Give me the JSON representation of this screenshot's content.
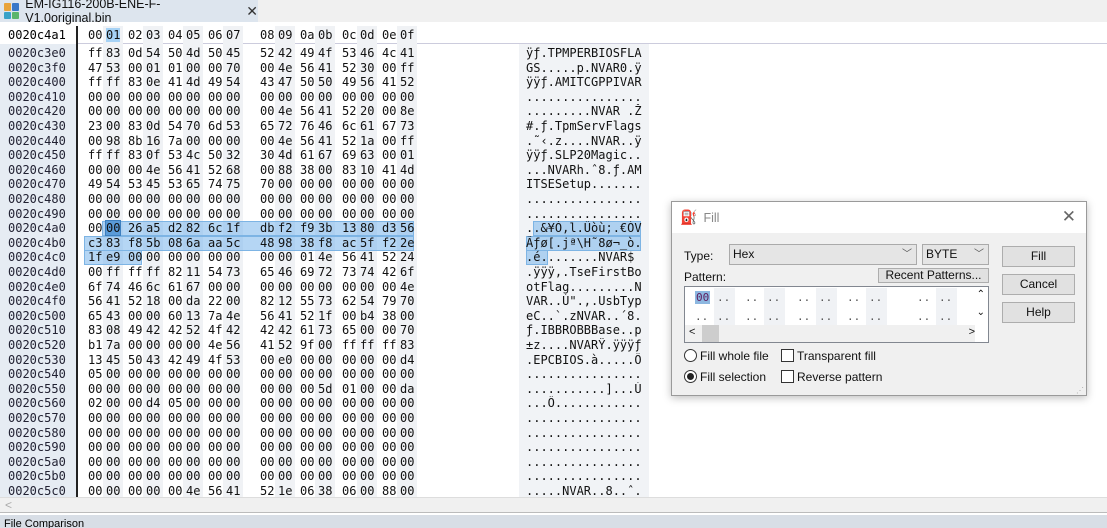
{
  "tab": {
    "filename": "EM-IG116-200B-ENE-F-V1.0original.bin",
    "close": "✕"
  },
  "header": {
    "cursor_address": "0020c4a1",
    "columns": [
      "00",
      "01",
      "02",
      "03",
      "04",
      "05",
      "06",
      "07",
      "08",
      "09",
      "0a",
      "0b",
      "0c",
      "0d",
      "0e",
      "0f"
    ],
    "active_column": 1
  },
  "rows": [
    {
      "addr": "0020c3e0",
      "hex": "ff 83 0d 54 50 4d 50 45 52 42 49 4f 53 46 4c 41",
      "ascii": "ÿƒ.TPMPERBIOSFLA"
    },
    {
      "addr": "0020c3f0",
      "hex": "47 53 00 01 01 00 00 70 00 4e 56 41 52 30 00 ff",
      "ascii": "GS.....p.NVAR0.ÿ"
    },
    {
      "addr": "0020c400",
      "hex": "ff ff 83 0e 41 4d 49 54 43 47 50 50 49 56 41 52",
      "ascii": "ÿÿƒ.AMITCGPPIVAR"
    },
    {
      "addr": "0020c410",
      "hex": "00 00 00 00 00 00 00 00 00 00 00 00 00 00 00 00",
      "ascii": "................"
    },
    {
      "addr": "0020c420",
      "hex": "00 00 00 00 00 00 00 00 00 4e 56 41 52 20 00 8e",
      "ascii": ".........NVAR .Ž"
    },
    {
      "addr": "0020c430",
      "hex": "23 00 83 0d 54 70 6d 53 65 72 76 46 6c 61 67 73",
      "ascii": "#.ƒ.TpmServFlags"
    },
    {
      "addr": "0020c440",
      "hex": "00 98 8b 16 7a 00 00 00 00 4e 56 41 52 1a 00 ff",
      "ascii": ".˜‹.z....NVAR..ÿ"
    },
    {
      "addr": "0020c450",
      "hex": "ff ff 83 0f 53 4c 50 32 30 4d 61 67 69 63 00 01",
      "ascii": "ÿÿƒ.SLP20Magic.."
    },
    {
      "addr": "0020c460",
      "hex": "00 00 00 4e 56 41 52 68 00 88 38 00 83 10 41 4d",
      "ascii": "...NVARh.ˆ8.ƒ.AM"
    },
    {
      "addr": "0020c470",
      "hex": "49 54 53 45 53 65 74 75 70 00 00 00 00 00 00 00",
      "ascii": "ITSESetup......."
    },
    {
      "addr": "0020c480",
      "hex": "00 00 00 00 00 00 00 00 00 00 00 00 00 00 00 00",
      "ascii": "................"
    },
    {
      "addr": "0020c490",
      "hex": "00 00 00 00 00 00 00 00 00 00 00 00 00 00 00 00",
      "ascii": "................"
    },
    {
      "addr": "0020c4a0",
      "hex": "00 00 26 a5 d2 82 6c 1f db f2 f9 3b 13 80 d3 56",
      "ascii": "..&¥Ò‚l.Ûòù;.€ÓV"
    },
    {
      "addr": "0020c4b0",
      "hex": "c3 83 f8 5b 08 6a aa 5c 48 98 38 f8 ac 5f f2 2e",
      "ascii": "Ãƒø[.jª\\H˜8ø¬_ò."
    },
    {
      "addr": "0020c4c0",
      "hex": "1f e9 00 00 00 00 00 00 00 00 01 4e 56 41 52 24",
      "ascii": ".é........NVAR$"
    },
    {
      "addr": "0020c4d0",
      "hex": "00 ff ff ff 82 11 54 73 65 46 69 72 73 74 42 6f",
      "ascii": ".ÿÿÿ‚.TseFirstBo"
    },
    {
      "addr": "0020c4e0",
      "hex": "6f 74 46 6c 61 67 00 00 00 00 00 00 00 00 00 4e",
      "ascii": "otFlag.........N"
    },
    {
      "addr": "0020c4f0",
      "hex": "56 41 52 18 00 da 22 00 82 12 55 73 62 54 79 70",
      "ascii": "VAR..Ú\".‚.UsbTyp"
    },
    {
      "addr": "0020c500",
      "hex": "65 43 00 00 60 13 7a 4e 56 41 52 1f 00 b4 38 00",
      "ascii": "eC..`.zNVAR..´8."
    },
    {
      "addr": "0020c510",
      "hex": "83 08 49 42 42 52 4f 42 42 42 61 73 65 00 00 70",
      "ascii": "ƒ.IBBROBBBase..p"
    },
    {
      "addr": "0020c520",
      "hex": "b1 7a 00 00 00 00 4e 56 41 52 9f 00 ff ff ff 83",
      "ascii": "±z....NVARŸ.ÿÿÿƒ"
    },
    {
      "addr": "0020c530",
      "hex": "13 45 50 43 42 49 4f 53 00 e0 00 00 00 00 00 d4",
      "ascii": ".EPCBIOS.à.....Ô"
    },
    {
      "addr": "0020c540",
      "hex": "05 00 00 00 00 00 00 00 00 00 00 00 00 00 00 00",
      "ascii": "................"
    },
    {
      "addr": "0020c550",
      "hex": "00 00 00 00 00 00 00 00 00 00 00 5d 01 00 00 da",
      "ascii": "...........]...Ú"
    },
    {
      "addr": "0020c560",
      "hex": "02 00 00 d4 05 00 00 00 00 00 00 00 00 00 00 00",
      "ascii": "...Ô............"
    },
    {
      "addr": "0020c570",
      "hex": "00 00 00 00 00 00 00 00 00 00 00 00 00 00 00 00",
      "ascii": "................"
    },
    {
      "addr": "0020c580",
      "hex": "00 00 00 00 00 00 00 00 00 00 00 00 00 00 00 00",
      "ascii": "................"
    },
    {
      "addr": "0020c590",
      "hex": "00 00 00 00 00 00 00 00 00 00 00 00 00 00 00 00",
      "ascii": "................"
    },
    {
      "addr": "0020c5a0",
      "hex": "00 00 00 00 00 00 00 00 00 00 00 00 00 00 00 00",
      "ascii": "................"
    },
    {
      "addr": "0020c5b0",
      "hex": "00 00 00 00 00 00 00 00 00 00 00 00 00 00 00 00",
      "ascii": "................"
    },
    {
      "addr": "0020c5c0",
      "hex": "00 00 00 00 00 4e 56 41 52 1e 06 38 06 00 88 00",
      "ascii": ".....NVAR..8..ˆ."
    }
  ],
  "selection": {
    "start": "0020c4a1",
    "end": "0020c4c2"
  },
  "status": {
    "text": "File Comparison"
  },
  "dialog": {
    "title": "Fill",
    "close": "✕",
    "type_label": "Type:",
    "type_value": "Hex",
    "size_value": "BYTE",
    "pattern_label": "Pattern:",
    "recent_patterns": "Recent Patterns...",
    "pattern_first_byte": "00",
    "pattern_placeholder": "..",
    "fill_whole_file": "Fill whole file",
    "fill_selection": "Fill selection",
    "fill_selection_checked": true,
    "transparent_fill": "Transparent fill",
    "transparent_fill_checked": false,
    "reverse_pattern": "Reverse pattern",
    "reverse_pattern_checked": false,
    "buttons": {
      "fill": "Fill",
      "cancel": "Cancel",
      "help": "Help"
    }
  }
}
